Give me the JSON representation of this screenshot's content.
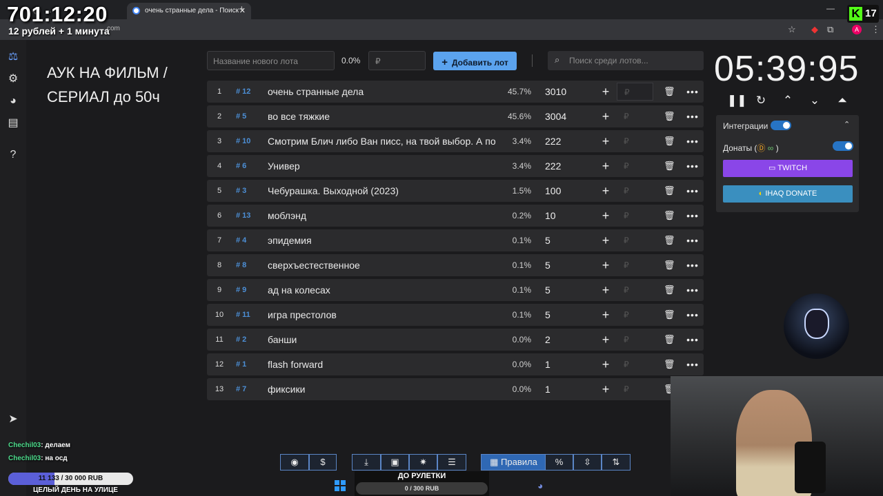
{
  "browser": {
    "tab1_title": "...",
    "tab2_title": "очень странные дела - Поиск",
    "url_fragment": "com",
    "new_tab": "+",
    "avatar_letter": "A"
  },
  "overlay": {
    "timer": "701:12:20",
    "timer_sub": "12 рублей + 1 минута",
    "kick_count": "17",
    "kick_logo": "K"
  },
  "page": {
    "title": "АУК НА ФИЛЬМ / СЕРИАЛ до 50ч"
  },
  "controls": {
    "new_lot_placeholder": "Название нового лота",
    "new_lot_percent": "0.0%",
    "new_amount_placeholder": "₽",
    "add_button": "Добавить лот",
    "search_placeholder": "Поиск среди лотов..."
  },
  "lots": [
    {
      "idx": "1",
      "num": "# 12",
      "name": "очень странные дела",
      "pct": "45.7%",
      "amount": "3010"
    },
    {
      "idx": "2",
      "num": "# 5",
      "name": "во все тяжкие",
      "pct": "45.6%",
      "amount": "3004"
    },
    {
      "idx": "3",
      "num": "# 10",
      "name": "Смотрим Блич либо Ван писс, на твой выбор. А по",
      "pct": "3.4%",
      "amount": "222"
    },
    {
      "idx": "4",
      "num": "# 6",
      "name": "Универ",
      "pct": "3.4%",
      "amount": "222"
    },
    {
      "idx": "5",
      "num": "# 3",
      "name": "Чебурашка. Выходной (2023)",
      "pct": "1.5%",
      "amount": "100"
    },
    {
      "idx": "6",
      "num": "# 13",
      "name": "моблэнд",
      "pct": "0.2%",
      "amount": "10"
    },
    {
      "idx": "7",
      "num": "# 4",
      "name": "эпидемия",
      "pct": "0.1%",
      "amount": "5"
    },
    {
      "idx": "8",
      "num": "# 8",
      "name": "сверхъестественное",
      "pct": "0.1%",
      "amount": "5"
    },
    {
      "idx": "9",
      "num": "# 9",
      "name": "ад на колесах",
      "pct": "0.1%",
      "amount": "5"
    },
    {
      "idx": "10",
      "num": "# 11",
      "name": "игра престолов",
      "pct": "0.1%",
      "amount": "5"
    },
    {
      "idx": "11",
      "num": "# 2",
      "name": "банши",
      "pct": "0.0%",
      "amount": "2"
    },
    {
      "idx": "12",
      "num": "# 1",
      "name": "flash forward",
      "pct": "0.0%",
      "amount": "1"
    },
    {
      "idx": "13",
      "num": "# 7",
      "name": "фиксики",
      "pct": "0.0%",
      "amount": "1"
    }
  ],
  "lot_row": {
    "rub": "₽",
    "plus": "+",
    "more": "•••"
  },
  "clock": {
    "time": "05:39:95"
  },
  "integrations": {
    "label": "Интеграции",
    "donations_label": "Донаты (",
    "donations_close": ")",
    "twitch": "TWITCH",
    "ihaq": "IHAQ DONATE"
  },
  "chat": [
    {
      "user": "Chechil03",
      "text": ": делаем"
    },
    {
      "user": "Chechil03",
      "text": ": на осд"
    }
  ],
  "goal": {
    "text": "11 133 / 30 000 RUB",
    "progress": 0.37,
    "title": "ЦЕЛЫЙ ДЕНЬ НА УЛИЦЕ"
  },
  "toolbar": {
    "rules": "Правила",
    "percent": "%"
  },
  "roulette": {
    "title": "ДО РУЛЕТКИ",
    "progress_text": "0 / 300 RUB"
  },
  "colors": {
    "accent": "#5ba3ee",
    "twitch": "#8a46e8",
    "ihaq": "#3a8fbf",
    "lot_number": "#4c8fd6",
    "kick": "#53fc18"
  }
}
